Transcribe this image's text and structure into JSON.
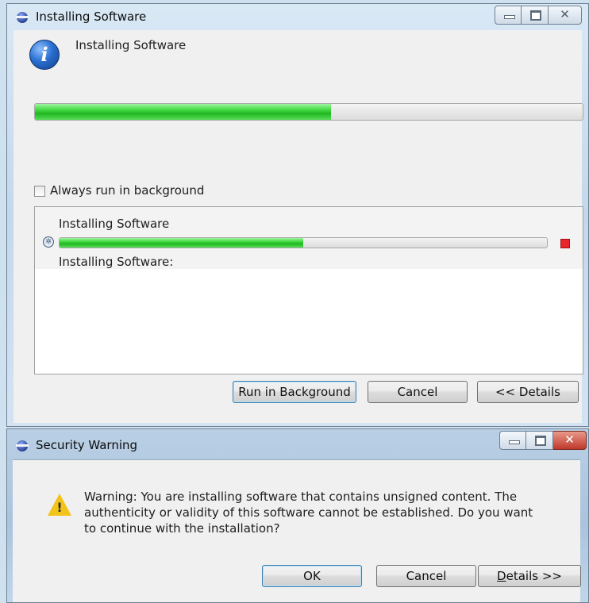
{
  "install_window": {
    "title": "Installing Software",
    "heading": "Installing Software",
    "overall_progress": 0.54,
    "always_run_label": "Always run in background",
    "always_run_checked": false,
    "job": {
      "name": "Installing Software",
      "progress": 0.5,
      "subtask": "Installing Software:"
    },
    "buttons": {
      "run_in_background": "Run in Background",
      "cancel": "Cancel",
      "details": "<< Details"
    }
  },
  "security_window": {
    "title": "Security Warning",
    "message": "Warning: You are installing software that contains unsigned content. The authenticity or validity of this software cannot be established. Do you want to continue with the installation?",
    "buttons": {
      "ok": "OK",
      "cancel": "Cancel",
      "details_prefix": "D",
      "details_rest": "etails >>"
    }
  },
  "colors": {
    "progress_green": "#22b522",
    "stop_red": "#e8262c",
    "warning_yellow": "#f2c318",
    "info_blue": "#2a6fd1"
  },
  "icons": [
    "app-icon",
    "info-icon",
    "job-icon",
    "stop-icon",
    "warning-icon",
    "minimize-icon",
    "maximize-icon",
    "close-icon"
  ]
}
